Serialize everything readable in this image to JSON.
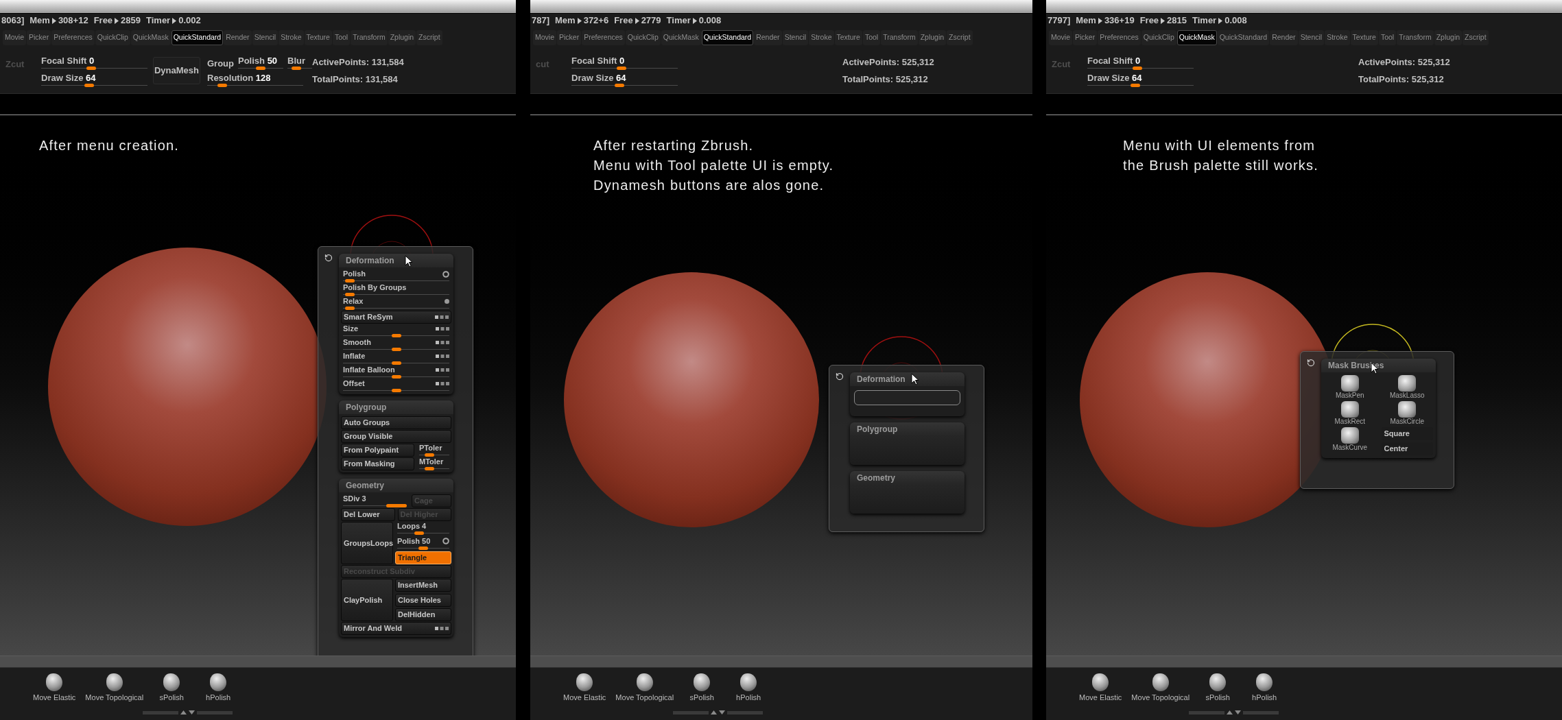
{
  "panels": [
    {
      "status": [
        {
          "label": "8063]"
        },
        {
          "label": "Mem",
          "value": "308+12"
        },
        {
          "label": "Free",
          "value": "2859"
        },
        {
          "label": "Timer",
          "value": "0.002"
        }
      ],
      "menus": [
        {
          "label": "Movie",
          "selected": false
        },
        {
          "label": "Picker",
          "selected": false
        },
        {
          "label": "Preferences",
          "selected": false
        },
        {
          "label": "QuickClip",
          "selected": false
        },
        {
          "label": "QuickMask",
          "selected": false
        },
        {
          "label": "QuickStandard",
          "selected": true
        },
        {
          "label": "Render",
          "selected": false
        },
        {
          "label": "Stencil",
          "selected": false
        },
        {
          "label": "Stroke",
          "selected": false
        },
        {
          "label": "Texture",
          "selected": false
        },
        {
          "label": "Tool",
          "selected": false
        },
        {
          "label": "Transform",
          "selected": false
        },
        {
          "label": "Zplugin",
          "selected": false
        },
        {
          "label": "Zscript",
          "selected": false
        }
      ],
      "toolbar": {
        "zcut": "Zcut",
        "sliders": [
          {
            "label": "Focal Shift",
            "value": "0",
            "level": 0.47
          },
          {
            "label": "Draw Size",
            "value": "64",
            "level": 0.45
          }
        ],
        "dynamesh": {
          "button": "DynaMesh",
          "group": "Group",
          "polish": {
            "label": "Polish",
            "value": "50",
            "level": 0.5
          },
          "blur": {
            "label": "Blur",
            "level": 0.25
          },
          "resolution": {
            "label": "Resolution",
            "value": "128",
            "level": 0.12
          }
        },
        "points": [
          {
            "label": "ActivePoints:",
            "value": "131,584"
          },
          {
            "label": "TotalPoints:",
            "value": "131,584"
          }
        ]
      },
      "caption": [
        "After menu creation."
      ],
      "menu_window": {
        "subpalettes": [
          {
            "title": "Deformation",
            "items": [
              {
                "kind": "slider",
                "label": "Polish",
                "level": 0.02,
                "toggle_on": false
              },
              {
                "kind": "slider",
                "label": "Polish By Groups",
                "level": 0.02
              },
              {
                "kind": "slider",
                "label": "Relax",
                "level": 0.02,
                "toggle_on": true
              },
              {
                "kind": "button",
                "label": "Smart ReSym",
                "disabled": false,
                "axes": true
              },
              {
                "kind": "slider",
                "label": "Size",
                "level": 0.5,
                "axes": true
              },
              {
                "kind": "slider",
                "label": "Smooth",
                "level": 0.5,
                "axes": true
              },
              {
                "kind": "slider",
                "label": "Inflate",
                "level": 0.5,
                "axes": true
              },
              {
                "kind": "slider",
                "label": "Inflate Balloon",
                "level": 0.5,
                "axes": true
              },
              {
                "kind": "slider",
                "label": "Offset",
                "level": 0.5,
                "axes": true
              }
            ]
          },
          {
            "title": "Polygroup",
            "items": [
              {
                "kind": "button",
                "label": "Auto Groups",
                "disabled": false
              },
              {
                "kind": "button",
                "label": "Group Visible",
                "disabled": false
              },
              {
                "kind": "button_slider",
                "label": "From Polypaint",
                "disabled": false,
                "slider": {
                  "label": "PToler",
                  "level": 0.25
                }
              },
              {
                "kind": "button_slider",
                "label": "From Masking",
                "disabled": false,
                "slider": {
                  "label": "MToler",
                  "level": 0.25
                }
              }
            ]
          },
          {
            "title": "Geometry",
            "items": [
              {
                "kind": "slider_button",
                "label": "SDiv 3",
                "level": 1,
                "button": {
                  "label": "Cage",
                  "disabled": true
                }
              },
              {
                "kind": "button_pair",
                "buttons": [
                  {
                    "label": "Del Lower",
                    "disabled": false
                  },
                  {
                    "label": "Del Higher",
                    "disabled": true
                  }
                ]
              },
              {
                "kind": "block",
                "label": "GroupsLoops",
                "disabled": false,
                "items": [
                  {
                    "kind": "slider",
                    "label": "Loops 4",
                    "level": 0.4
                  },
                  {
                    "kind": "slider",
                    "label": "Polish 50",
                    "level": 0.5,
                    "toggle_on": false
                  },
                  {
                    "kind": "toggle",
                    "label": "Triangle",
                    "on": true
                  }
                ]
              },
              {
                "kind": "button",
                "label": "Reconstruct Subdiv",
                "disabled": true
              },
              {
                "kind": "block",
                "label": "ClayPolish",
                "disabled": false,
                "items": [
                  {
                    "kind": "button",
                    "label": "InsertMesh",
                    "disabled": false
                  },
                  {
                    "kind": "button",
                    "label": "Close Holes",
                    "disabled": false
                  },
                  {
                    "kind": "button",
                    "label": "DelHidden",
                    "disabled": false
                  }
                ]
              },
              {
                "kind": "button",
                "label": "Mirror And Weld",
                "disabled": false,
                "axes": true
              }
            ]
          }
        ]
      },
      "shelf": [
        "Move Elastic",
        "Move Topological",
        "sPolish",
        "hPolish"
      ]
    },
    {
      "status": [
        {
          "label": "787]"
        },
        {
          "label": "Mem",
          "value": "372+6"
        },
        {
          "label": "Free",
          "value": "2779"
        },
        {
          "label": "Timer",
          "value": "0.008"
        }
      ],
      "menus": [
        {
          "label": "Movie",
          "selected": false
        },
        {
          "label": "Picker",
          "selected": false
        },
        {
          "label": "Preferences",
          "selected": false
        },
        {
          "label": "QuickClip",
          "selected": false
        },
        {
          "label": "QuickMask",
          "selected": false
        },
        {
          "label": "QuickStandard",
          "selected": true
        },
        {
          "label": "Render",
          "selected": false
        },
        {
          "label": "Stencil",
          "selected": false
        },
        {
          "label": "Stroke",
          "selected": false
        },
        {
          "label": "Texture",
          "selected": false
        },
        {
          "label": "Tool",
          "selected": false
        },
        {
          "label": "Transform",
          "selected": false
        },
        {
          "label": "Zplugin",
          "selected": false
        },
        {
          "label": "Zscript",
          "selected": false
        }
      ],
      "toolbar": {
        "zcut": "cut",
        "sliders": [
          {
            "label": "Focal Shift",
            "value": "0",
            "level": 0.47
          },
          {
            "label": "Draw Size",
            "value": "64",
            "level": 0.45
          }
        ],
        "points": [
          {
            "label": "ActivePoints:",
            "value": "525,312"
          },
          {
            "label": "TotalPoints:",
            "value": "525,312"
          }
        ]
      },
      "caption": [
        "After restarting Zbrush.",
        "Menu with Tool palette UI is empty.",
        "Dynamesh buttons are alos gone."
      ],
      "menu_window": {
        "subpalettes": [
          {
            "title": "Deformation",
            "frame": true
          },
          {
            "title": "Polygroup"
          },
          {
            "title": "Geometry"
          }
        ]
      },
      "shelf": [
        "Move Elastic",
        "Move Topological",
        "sPolish",
        "hPolish"
      ]
    },
    {
      "status": [
        {
          "label": "7797]"
        },
        {
          "label": "Mem",
          "value": "336+19"
        },
        {
          "label": "Free",
          "value": "2815"
        },
        {
          "label": "Timer",
          "value": "0.008"
        }
      ],
      "menus": [
        {
          "label": "Movie",
          "selected": false
        },
        {
          "label": "Picker",
          "selected": false
        },
        {
          "label": "Preferences",
          "selected": false
        },
        {
          "label": "QuickClip",
          "selected": false
        },
        {
          "label": "QuickMask",
          "selected": true
        },
        {
          "label": "QuickStandard",
          "selected": false
        },
        {
          "label": "Render",
          "selected": false
        },
        {
          "label": "Stencil",
          "selected": false
        },
        {
          "label": "Stroke",
          "selected": false
        },
        {
          "label": "Texture",
          "selected": false
        },
        {
          "label": "Tool",
          "selected": false
        },
        {
          "label": "Transform",
          "selected": false
        },
        {
          "label": "Zplugin",
          "selected": false
        },
        {
          "label": "Zscript",
          "selected": false
        }
      ],
      "toolbar": {
        "zcut": "Zcut",
        "sliders": [
          {
            "label": "Focal Shift",
            "value": "0",
            "level": 0.47
          },
          {
            "label": "Draw Size",
            "value": "64",
            "level": 0.45
          }
        ],
        "points": [
          {
            "label": "ActivePoints:",
            "value": "525,312"
          },
          {
            "label": "TotalPoints:",
            "value": "525,312"
          }
        ]
      },
      "caption": [
        "Menu with UI elements from",
        "the Brush palette still works."
      ],
      "menu_window": {
        "subpalettes": [
          {
            "title": "Mask Brushes",
            "brushes": [
              "MaskPen",
              "MaskLasso",
              "MaskRect",
              "MaskCircle",
              "MaskCurve"
            ],
            "buttons": [
              "Square",
              "Center"
            ]
          }
        ]
      },
      "shelf": [
        "Move Elastic",
        "Move Topological",
        "sPolish",
        "hPolish"
      ]
    }
  ]
}
